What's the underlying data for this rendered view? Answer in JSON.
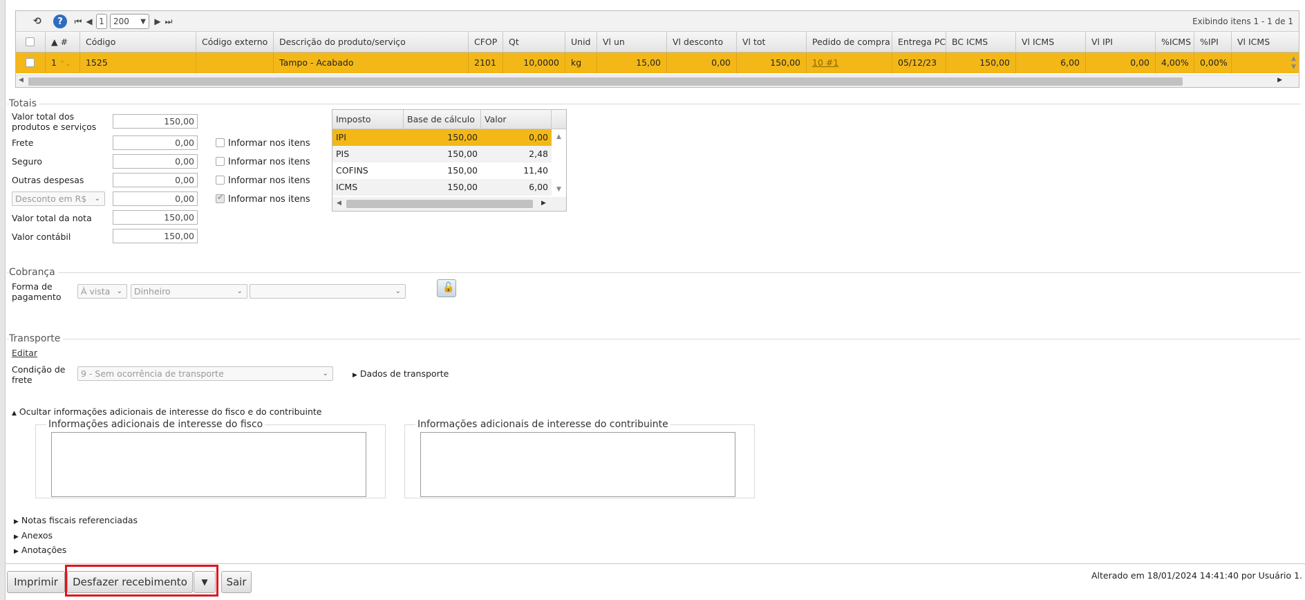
{
  "grid": {
    "toolbar": {
      "refresh_icon": "refresh-icon",
      "help_label": "?",
      "page_current": "1",
      "page_size": "200",
      "status": "Exibindo itens 1 - 1 de 1"
    },
    "columns": [
      "#",
      "Código",
      "Código externo",
      "Descrição do produto/serviço",
      "CFOP",
      "Qt",
      "Unid",
      "Vl un",
      "Vl desconto",
      "Vl tot",
      "Pedido de compra",
      "Entrega PC",
      "BC ICMS",
      "Vl ICMS",
      "Vl IPI",
      "%ICMS",
      "%IPI",
      "Vl ICMS"
    ],
    "row": {
      "num": "1",
      "codigo": "1525",
      "codigo_externo": "",
      "descricao": "Tampo - Acabado",
      "cfop": "2101",
      "qt": "10,0000",
      "unid": "kg",
      "vl_un": "15,00",
      "vl_desconto": "0,00",
      "vl_tot": "150,00",
      "pedido": "10 #1",
      "entrega": "05/12/23",
      "bc_icms": "150,00",
      "vl_icms": "6,00",
      "vl_ipi": "0,00",
      "pct_icms": "4,00%",
      "pct_ipi": "0,00%",
      "vl_icms2": ""
    },
    "highlight_color": "#f3b818"
  },
  "totais": {
    "title": "Totais",
    "valor_total_label": "Valor total dos produtos e serviços",
    "valor_total": "150,00",
    "frete_label": "Frete",
    "frete": "0,00",
    "seguro_label": "Seguro",
    "seguro": "0,00",
    "outras_label": "Outras despesas",
    "outras": "0,00",
    "desconto_select": "Desconto em R$",
    "desconto": "0,00",
    "valor_nota_label": "Valor total da nota",
    "valor_nota": "150,00",
    "valor_contabil_label": "Valor contábil",
    "valor_contabil": "150,00",
    "informar_label": "Informar nos itens"
  },
  "impostos": {
    "headers": [
      "Imposto",
      "Base de cálculo",
      "Valor"
    ],
    "rows": [
      {
        "imposto": "IPI",
        "base": "150,00",
        "valor": "0,00"
      },
      {
        "imposto": "PIS",
        "base": "150,00",
        "valor": "2,48"
      },
      {
        "imposto": "COFINS",
        "base": "150,00",
        "valor": "11,40"
      },
      {
        "imposto": "ICMS",
        "base": "150,00",
        "valor": "6,00"
      }
    ]
  },
  "cobranca": {
    "title": "Cobrança",
    "forma_label": "Forma de pagamento",
    "forma1": "À vista",
    "forma2": "Dinheiro",
    "forma3": ""
  },
  "transporte": {
    "title": "Transporte",
    "editar": "Editar",
    "condicao_label": "Condição de frete",
    "condicao": "9 - Sem ocorrência de transporte",
    "dados": "Dados de transporte"
  },
  "adicionais": {
    "toggle": "Ocultar informações adicionais de interesse do fisco e do contribuinte",
    "fisco": "Informações adicionais de interesse do fisco",
    "contribuinte": "Informações adicionais de interesse do contribuinte"
  },
  "expanders": {
    "notas": "Notas fiscais referenciadas",
    "anexos": "Anexos",
    "anotacoes": "Anotações"
  },
  "footer": {
    "imprimir": "Imprimir",
    "desfazer": "Desfazer recebimento",
    "sair": "Sair",
    "status": "Alterado em 18/01/2024 14:41:40 por Usuário 1."
  }
}
